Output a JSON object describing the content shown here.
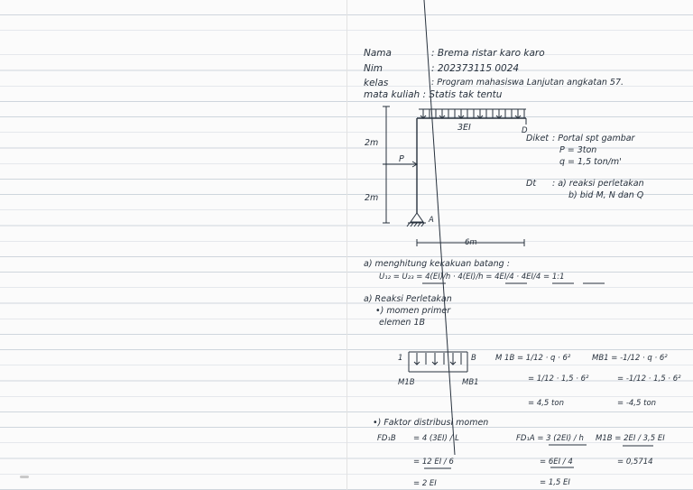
{
  "header": {
    "nama_label": "Nama",
    "nama_value": ": Brema ristar karo karo",
    "nim_label": "Nim",
    "nim_value": ": 202373115 0024",
    "kelas_label": "kelas",
    "kelas_value": ": Program mahasiswa Lanjutan angkatan 57.",
    "matkul_line": "mata kuliah : Statis tak tentu"
  },
  "figure": {
    "beam_label": "3EI",
    "node_d": "D",
    "dim_2m_top": "2m",
    "dim_2m_bottom": "2m",
    "load_p": "P",
    "support_a": "A",
    "span": "6m"
  },
  "given": {
    "label": "Diket",
    "item1": ": Portal spt gambar",
    "item2": "P = 3ton",
    "item3": "q = 1,5 ton/m'"
  },
  "asked": {
    "label": "Dt",
    "item1": ": a) reaksi perletakan",
    "item2": "b) bid M, N dan Q"
  },
  "section_a": {
    "heading": "a) menghitung kekakuan batang :",
    "formula": "U₁₂ = U₂₃ = 4(EI)/h · 4(EI)/h = 4EI/4 · 4EI/4 = 1:1"
  },
  "reaction": {
    "heading": "a) Reaksi Perletakan",
    "sub": "•) momen primer",
    "element": "elemen 1B",
    "beam_left": "1",
    "beam_right": "B",
    "m1b": "M1B",
    "mb1": "MB1",
    "m1b_eq1": "M 1B = 1/12 · q · 6²",
    "m1b_eq2": "= 1/12 · 1,5 · 6²",
    "m1b_eq3": "= 4,5 ton",
    "mb1_eq1": "MB1 = -1/12 · q · 6²",
    "mb1_eq2": "= -1/12 · 1,5 · 6²",
    "mb1_eq3": "= -4,5 ton"
  },
  "distribution": {
    "heading": "•) Faktor distribusi momen",
    "fd1b_label": "FD₁B",
    "fd1b_eq1": "= 4 (3EI) / L",
    "fd1b_eq2": "= 12 EI / 6",
    "fd1b_eq3": "= 2 EI",
    "fd1a_eq1": "FD₁A = 3 (2EI) / h",
    "fd1a_eq2": "= 6EI / 4",
    "fd1a_eq3": "= 1,5 EI",
    "mu1b_eq1": "M1B = 2EI / 3,5 EI",
    "mu1b_eq2": "= 0,5714"
  }
}
